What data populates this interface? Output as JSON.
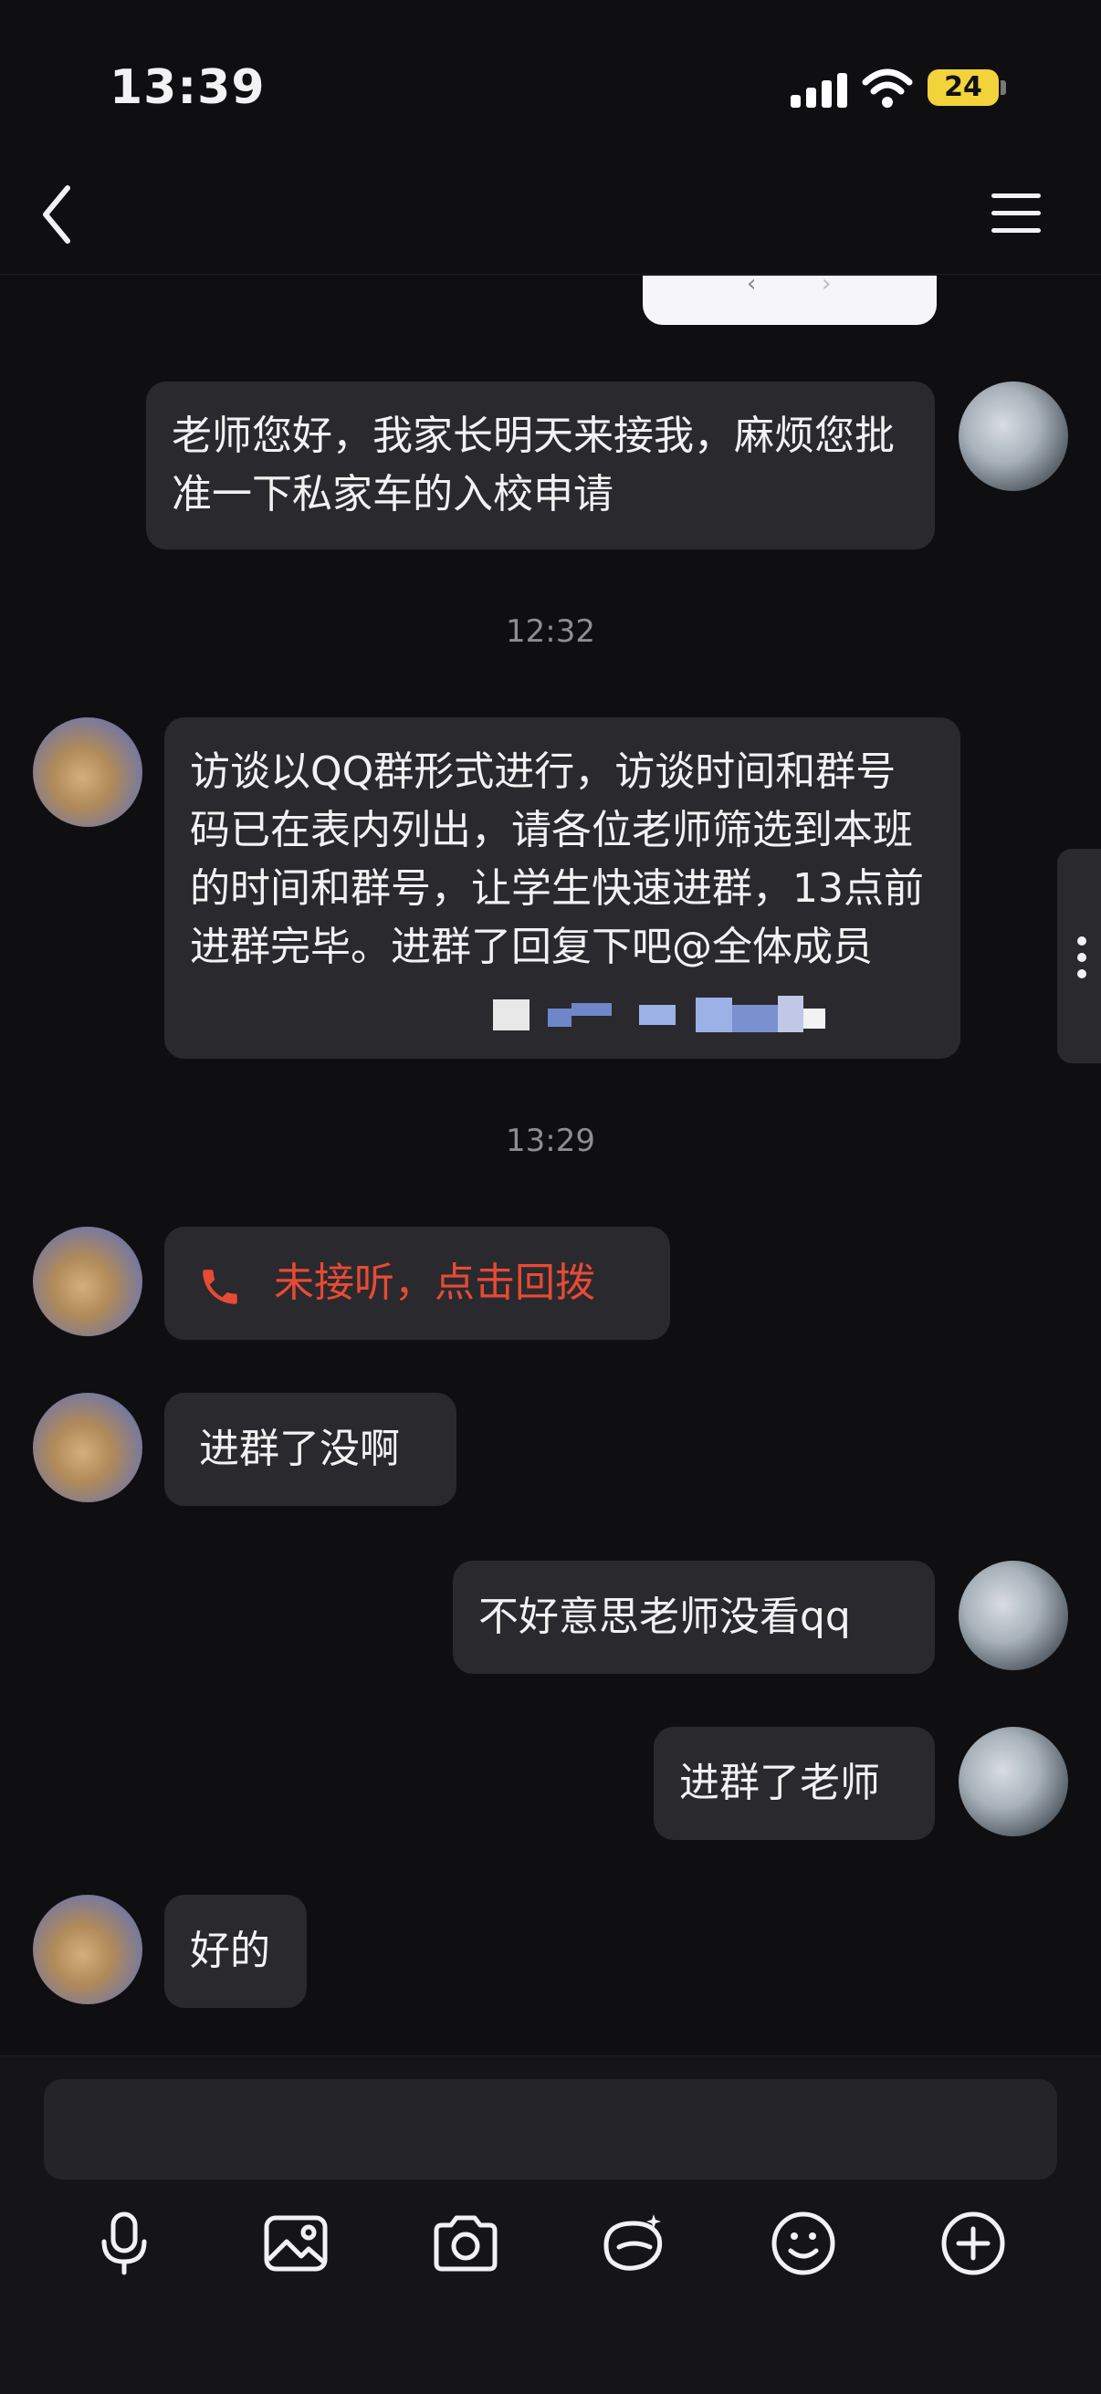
{
  "status_bar": {
    "time": "13:39",
    "battery": "24"
  },
  "header": {
    "contact_name": ""
  },
  "messages": [
    {
      "side": "right",
      "text": "老师您好，我家长明天来接我，麻烦您批准一下私家车的入校申请"
    },
    {
      "timestamp": "12:32"
    },
    {
      "side": "left",
      "text": "访谈以QQ群形式进行，访谈时间和群号码已在表内列出，请各位老师筛选到本班的时间和群号，让学生快速进群，13点前进群完毕。进群了回复下吧@全体成员"
    },
    {
      "timestamp": "13:29"
    },
    {
      "side": "left",
      "type": "missed-call",
      "text": "未接听，点击回拨"
    },
    {
      "side": "left",
      "text": "进群了没啊"
    },
    {
      "side": "right",
      "text": "不好意思老师没看qq"
    },
    {
      "side": "right",
      "text": "进群了老师"
    },
    {
      "side": "left",
      "text": "好的"
    }
  ],
  "toolbar": {
    "icons": [
      "microphone-icon",
      "image-icon",
      "camera-icon",
      "sticker-icon",
      "emoji-icon",
      "plus-icon"
    ]
  },
  "colors": {
    "background": "#0f0f12",
    "bubble": "#2a2a2e",
    "missed_call": "#e84a35",
    "battery": "#f2d33a"
  }
}
